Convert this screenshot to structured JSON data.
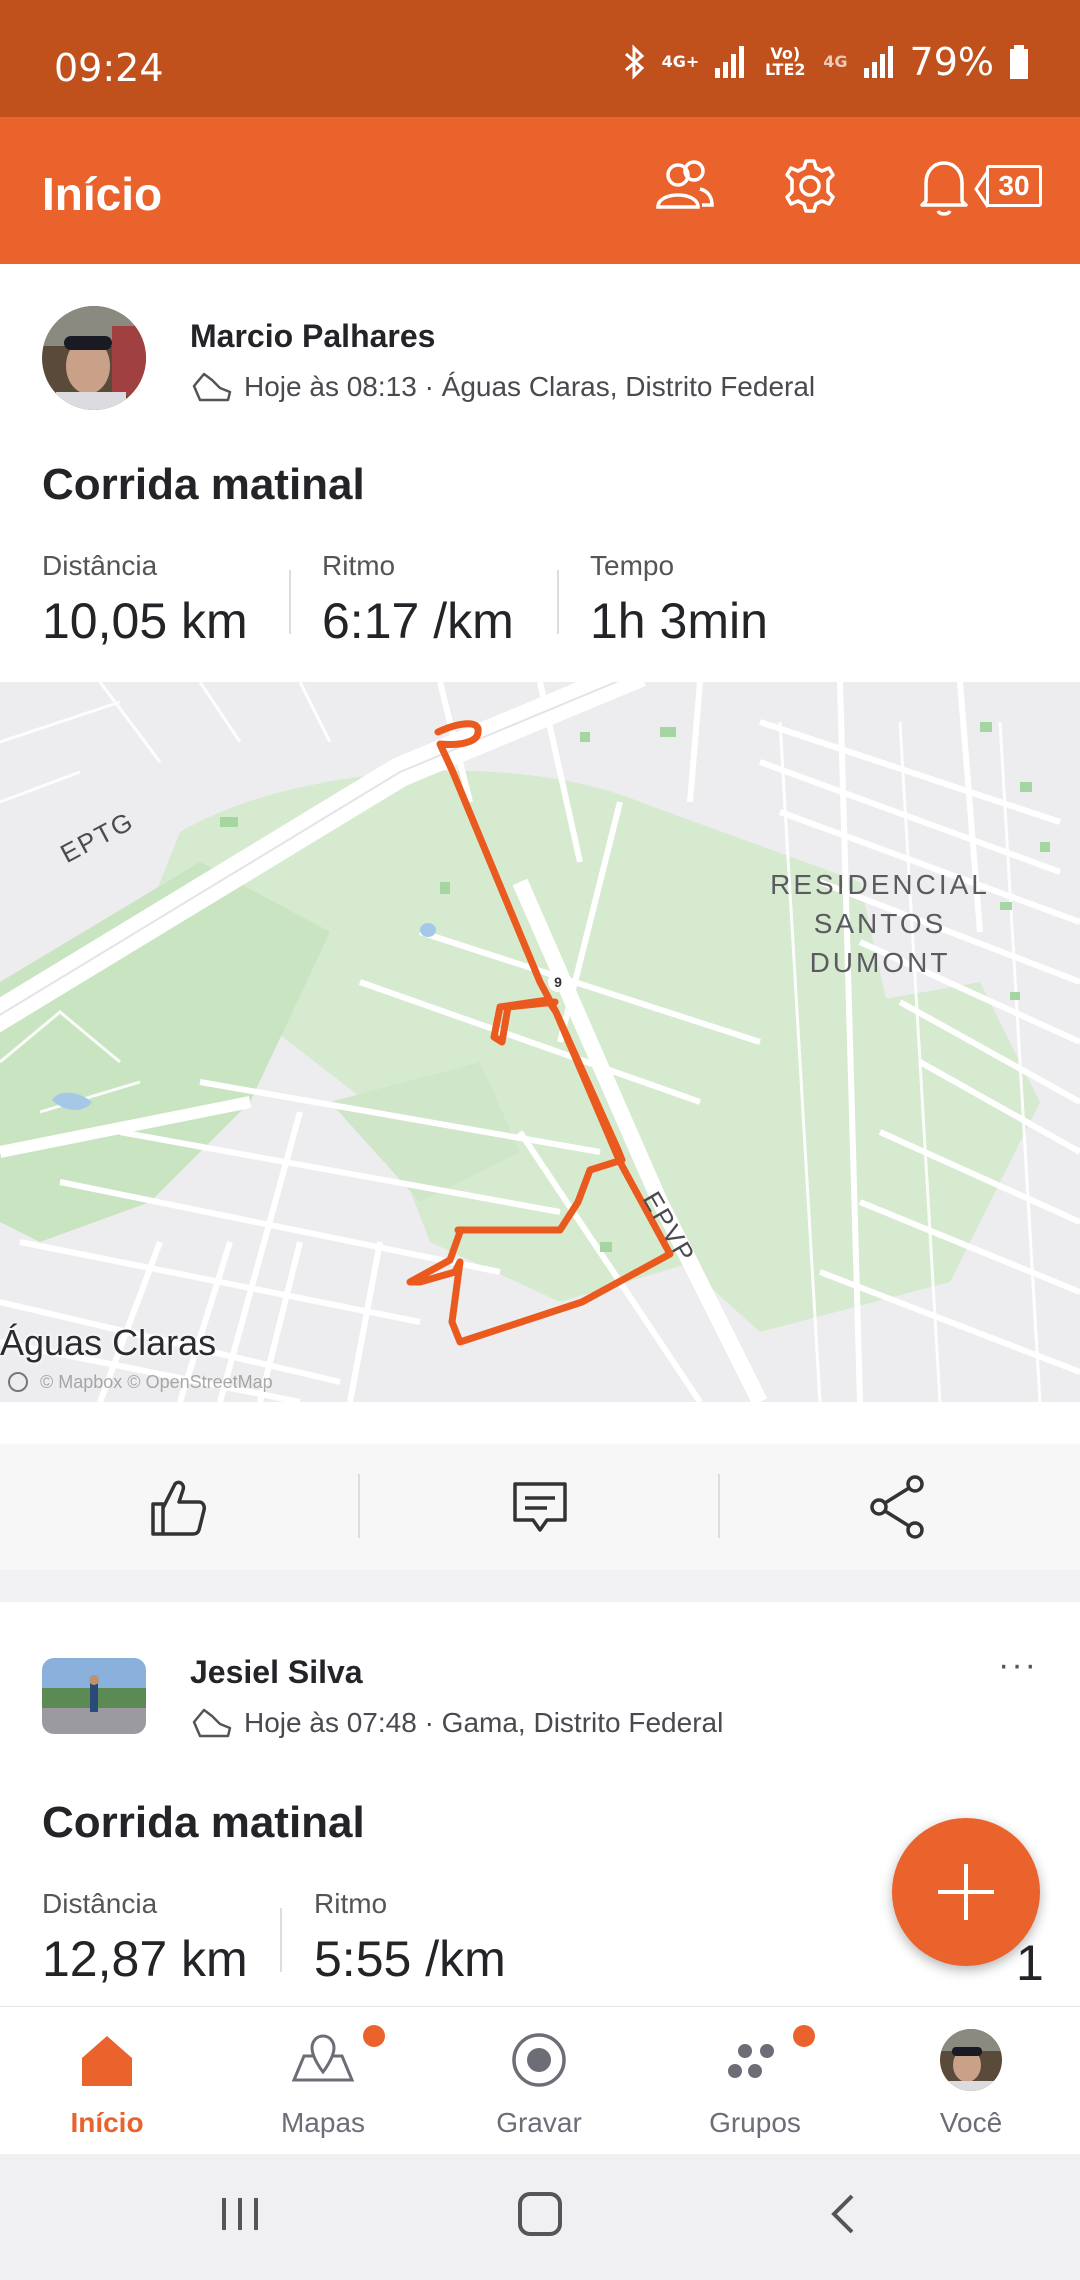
{
  "status_bar": {
    "time": "09:24",
    "net1": "4G+",
    "volte": "Vo) LTE2",
    "net2": "4G",
    "battery": "79%"
  },
  "app_bar": {
    "title": "Início",
    "notifications_count": "30",
    "icons": [
      "people-icon",
      "gear-icon",
      "bell-icon"
    ]
  },
  "feed": [
    {
      "athlete": "Marcio Palhares",
      "meta": "Hoje às 08:13 · Águas Claras, Distrito Federal",
      "title": "Corrida matinal",
      "stats": [
        {
          "label": "Distância",
          "value": "10,05 km"
        },
        {
          "label": "Ritmo",
          "value": "6:17 /km"
        },
        {
          "label": "Tempo",
          "value": "1h 3min"
        }
      ],
      "map": {
        "road_eptg": "EPTG",
        "road_epvp": "EPVP",
        "area": "RESIDENCIAL SANTOS DUMONT",
        "area_lines": [
          "RESIDENCIAL",
          "SANTOS",
          "DUMONT"
        ],
        "city": "Águas Claras",
        "road_number": "9",
        "attribution": "© Mapbox © OpenStreetMap",
        "route_color": "#ea5a1e"
      }
    },
    {
      "athlete": "Jesiel  Silva",
      "meta": "Hoje às 07:48 · Gama, Distrito Federal",
      "title": "Corrida matinal",
      "stats": [
        {
          "label": "Distância",
          "value": "12,87 km"
        },
        {
          "label": "Ritmo",
          "value": "5:55 /km"
        }
      ],
      "partial_value": "1",
      "more_label": "···"
    }
  ],
  "bottom_nav": [
    {
      "label": "Início",
      "active": true
    },
    {
      "label": "Mapas"
    },
    {
      "label": "Gravar"
    },
    {
      "label": "Grupos"
    },
    {
      "label": "Você"
    }
  ],
  "colors": {
    "accent": "#ea622c",
    "status_bar": "#c0501c"
  }
}
